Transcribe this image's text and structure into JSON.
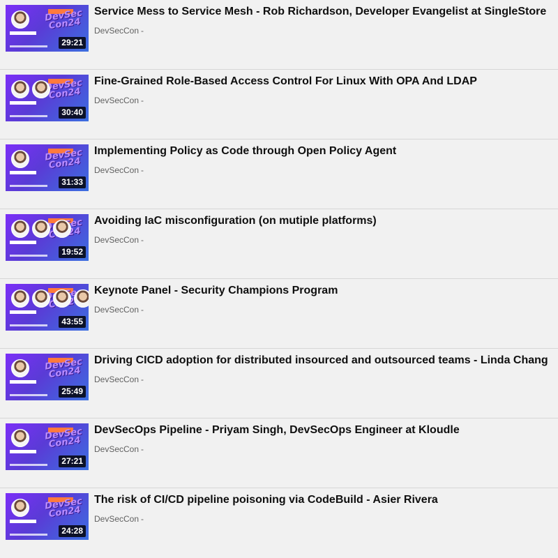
{
  "videos": [
    {
      "title": "Service Mess to Service Mesh - Rob Richardson, Developer Evangelist at SingleStore",
      "channel": "DevSecCon",
      "separator": "-",
      "duration": "29:21",
      "speakers": 1
    },
    {
      "title": "Fine-Grained Role-Based Access Control For Linux With OPA And LDAP",
      "channel": "DevSecCon",
      "separator": "-",
      "duration": "30:40",
      "speakers": 2
    },
    {
      "title": "Implementing Policy as Code through Open Policy Agent",
      "channel": "DevSecCon",
      "separator": "-",
      "duration": "31:33",
      "speakers": 1
    },
    {
      "title": "Avoiding IaC misconfiguration (on mutiple platforms)",
      "channel": "DevSecCon",
      "separator": "-",
      "duration": "19:52",
      "speakers": 3
    },
    {
      "title": "Keynote Panel - Security Champions Program",
      "channel": "DevSecCon",
      "separator": "-",
      "duration": "43:55",
      "speakers": 4
    },
    {
      "title": "Driving CICD adoption for distributed insourced and outsourced teams - Linda Chang",
      "channel": "DevSecCon",
      "separator": "-",
      "duration": "25:49",
      "speakers": 1
    },
    {
      "title": "DevSecOps Pipeline - Priyam Singh, DevSecOps Engineer at Kloudle",
      "channel": "DevSecCon",
      "separator": "-",
      "duration": "27:21",
      "speakers": 1
    },
    {
      "title": "The risk of CI/CD pipeline poisoning via CodeBuild - Asier Rivera",
      "channel": "DevSecCon",
      "separator": "-",
      "duration": "24:28",
      "speakers": 1
    }
  ],
  "thumbnail_brand": [
    "DevSec",
    "Con24"
  ],
  "colors": {
    "background": "#f1f1f1",
    "thumb_start": "#7b2ff7",
    "thumb_end": "#3b6fe0",
    "accent": "#ff7a3d"
  }
}
